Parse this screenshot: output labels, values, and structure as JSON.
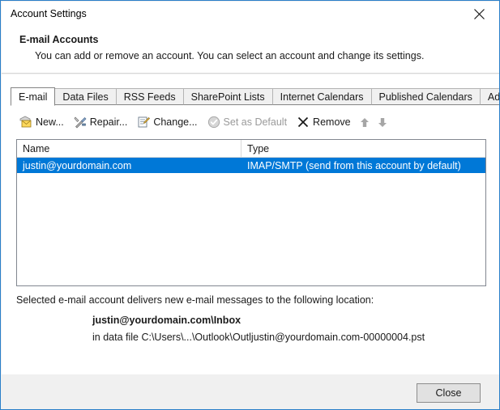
{
  "window": {
    "title": "Account Settings",
    "close_icon": "close-x-icon"
  },
  "header": {
    "title": "E-mail Accounts",
    "description": "You can add or remove an account. You can select an account and change its settings."
  },
  "tabs": [
    {
      "label": "E-mail",
      "active": true
    },
    {
      "label": "Data Files",
      "active": false
    },
    {
      "label": "RSS Feeds",
      "active": false
    },
    {
      "label": "SharePoint Lists",
      "active": false
    },
    {
      "label": "Internet Calendars",
      "active": false
    },
    {
      "label": "Published Calendars",
      "active": false
    },
    {
      "label": "Address Books",
      "active": false
    }
  ],
  "toolbar": {
    "new_label": "New...",
    "repair_label": "Repair...",
    "change_label": "Change...",
    "set_default_label": "Set as Default",
    "remove_label": "Remove",
    "move_up_icon": "arrow-up-icon",
    "move_down_icon": "arrow-down-icon"
  },
  "accounts_table": {
    "columns": [
      "Name",
      "Type"
    ],
    "rows": [
      {
        "name": "justin@yourdomain.com",
        "type": "IMAP/SMTP (send from this account by default)",
        "selected": true
      }
    ]
  },
  "delivery_info": {
    "caption": "Selected e-mail account delivers new e-mail messages to the following location:",
    "location": "justin@yourdomain.com\\Inbox",
    "data_file": "in data file C:\\Users\\...\\Outlook\\Outljustin@yourdomain.com-00000004.pst"
  },
  "footer": {
    "close_label": "Close"
  },
  "colors": {
    "accent_border": "#2a7fc9",
    "selection": "#0078d7",
    "dialog_bg": "#f0f0f0",
    "disabled_text": "#9a9a9a"
  }
}
